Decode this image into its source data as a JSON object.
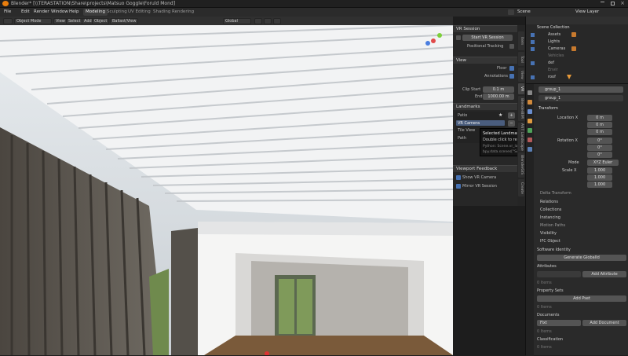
{
  "window": {
    "title": "Blender* [\\\\TERASTATION\\Share\\projects\\Matsuo Goggle\\Foruld Mond]"
  },
  "menu": [
    "File",
    "Edit",
    "Render",
    "Window",
    "Help"
  ],
  "workspaces": [
    "Modeling",
    "Sculpting",
    "UV Editing",
    "Shading",
    "Rendering"
  ],
  "workspace_active": "Modeling",
  "topbar_right": {
    "scene": "Scene",
    "view_layer": "View Layer"
  },
  "viewport_header": {
    "mode": "Object Mode",
    "view": "View",
    "select": "Select",
    "add": "Add",
    "object": "Object",
    "extra": "Ballast/View",
    "orientation": "Global"
  },
  "vr_panel": {
    "vr_session": {
      "header": "VR Session",
      "start_button": "Start VR Session",
      "positional_tracking": "Positional Tracking"
    },
    "view": {
      "header": "View",
      "floor": "Floor",
      "annotations": "Annotations",
      "clip_start_label": "Clip Start",
      "clip_start_value": "0.1 m",
      "end_label": "End",
      "end_value": "1000.00 m"
    },
    "landmarks": {
      "header": "Landmarks",
      "items": [
        "Patio",
        "VR Camera",
        "Tile View",
        "Path"
      ],
      "selected": "VR Camera"
    },
    "viewport_feedback": {
      "header": "Viewport Feedback",
      "show_vr_camera": "Show VR Camera",
      "mirror_vr_session": "Mirror VR Session"
    }
  },
  "tooltip": {
    "title": "Selected Landmark",
    "line1": "Double click to rename",
    "line2": "Python: Scene.vr_landmarks_selected",
    "line3": "bpy.data.scenes[\"Scene\"].vr_landmarks_selected"
  },
  "side_tabs": [
    "Item",
    "Tool",
    "View",
    "VR",
    "BlenderBIM",
    "ANT Landscape",
    "BlenderGIS",
    "Create"
  ],
  "outliner": {
    "title": "Scene Collection",
    "items": [
      "Assets",
      "Lights",
      "Cameras",
      "Vehicles",
      "def",
      "Envir",
      "roof"
    ]
  },
  "properties": {
    "object_name": "group_1",
    "data_name": "group_1",
    "transform_header": "Transform",
    "location": {
      "label": "Location X",
      "x": "0 m",
      "y": "0 m",
      "z": "0 m"
    },
    "rotation": {
      "label": "Rotation X",
      "x": "0°",
      "y": "0°",
      "z": "0°"
    },
    "mode_label": "Mode",
    "mode_value": "XYZ Euler",
    "scale": {
      "label": "Scale X",
      "x": "1.000",
      "y": "1.000",
      "z": "1.000"
    },
    "sections": [
      "Delta Transform",
      "Relations",
      "Collections",
      "Instancing",
      "Motion Paths",
      "Visibility",
      "IFC Object"
    ],
    "software_identity_label": "Software Identity",
    "generate_guid": "Generate GlobalId",
    "attributes_label": "Attributes",
    "add_attribute": "Add Attribute",
    "attributes_empty": "0 Items",
    "property_sets_label": "Property Sets",
    "add_pset": "Add Pset",
    "property_sets_empty": "0 Items",
    "documents_label": "Documents",
    "documents_value": "Fixt",
    "add_document": "Add Document",
    "documents_empty": "0 Items",
    "classification_label": "Classification",
    "classification_empty": "0 Items"
  }
}
